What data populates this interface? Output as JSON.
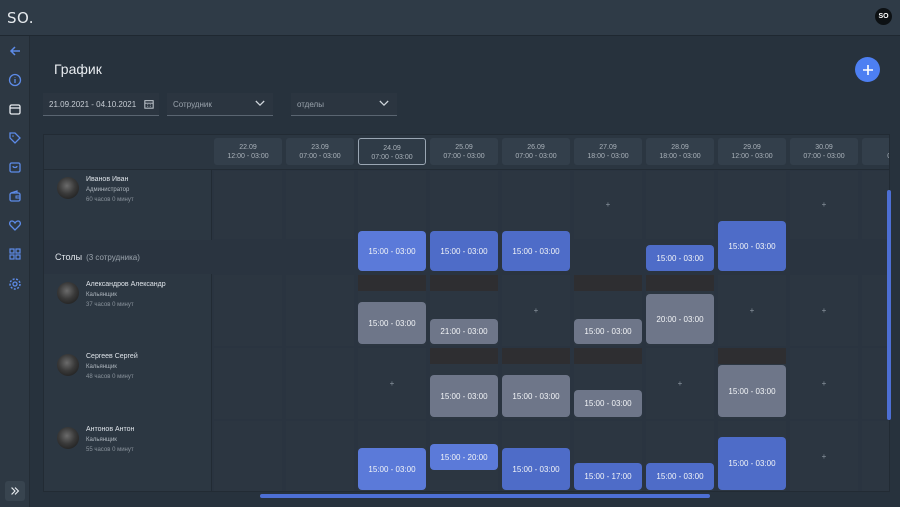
{
  "app": {
    "logo": "SO.",
    "user_initials": "SO"
  },
  "colors": {
    "accent": "#4d7ff2",
    "shift_blue": "#5b7ad9",
    "shift_gray": "#6e7689",
    "background": "#27323d"
  },
  "sidebar": {
    "icons": [
      "back-arrow-icon",
      "info-icon",
      "calendar-icon",
      "tag-icon",
      "shopping-bag-icon",
      "wallet-icon",
      "heart-icon",
      "grid-icon",
      "gear-icon"
    ],
    "expand_icon": "double-chevron-right-icon"
  },
  "page": {
    "title": "График"
  },
  "filters": {
    "date_range": "21.09.2021 - 04.10.2021",
    "employee_placeholder": "Сотрудник",
    "department_placeholder": "отделы"
  },
  "days": [
    {
      "date": "22.09",
      "hours": "12:00 - 03:00"
    },
    {
      "date": "23.09",
      "hours": "07:00 - 03:00"
    },
    {
      "date": "24.09",
      "hours": "07:00 - 03:00"
    },
    {
      "date": "25.09",
      "hours": "07:00 - 03:00"
    },
    {
      "date": "26.09",
      "hours": "07:00 - 03:00"
    },
    {
      "date": "27.09",
      "hours": "18:00 - 03:00"
    },
    {
      "date": "28.09",
      "hours": "18:00 - 03:00"
    },
    {
      "date": "29.09",
      "hours": "12:00 - 03:00"
    },
    {
      "date": "30.09",
      "hours": "07:00 - 03:00"
    },
    {
      "date": "0",
      "hours": "07:00"
    }
  ],
  "manager": {
    "name": "Иванов Иван",
    "role": "Администратор",
    "hours": "60 часов 0 минут"
  },
  "group": {
    "name": "Столы",
    "count": "(3 сотрудника)"
  },
  "employees": [
    {
      "name": "Александров Александр",
      "role": "Кальянщик",
      "hours": "37 часов 0 минут"
    },
    {
      "name": "Сергеев Сергей",
      "role": "Кальянщик",
      "hours": "48 часов 0 минут"
    },
    {
      "name": "Антонов Антон",
      "role": "Кальянщик",
      "hours": "55 часов 0 минут"
    }
  ],
  "shifts": {
    "manager": [
      "",
      "",
      "15:00 - 03:00",
      "15:00 - 03:00",
      "15:00 - 03:00",
      "+",
      "15:00 - 03:00",
      "15:00 - 03:00",
      "+",
      ""
    ],
    "e1": [
      "",
      "",
      "15:00 - 03:00",
      "21:00 - 03:00",
      "+",
      "15:00 - 03:00",
      "20:00 - 03:00",
      "+",
      "+",
      ""
    ],
    "e2": [
      "",
      "",
      "+",
      "15:00 - 03:00",
      "15:00 - 03:00",
      "15:00 - 03:00",
      "+",
      "15:00 - 03:00",
      "+",
      ""
    ],
    "e3": [
      "",
      "",
      "15:00 - 03:00",
      "15:00 - 20:00",
      "15:00 - 03:00",
      "15:00 - 17:00",
      "15:00 - 03:00",
      "15:00 - 03:00",
      "+",
      ""
    ]
  },
  "plus_symbol": "+"
}
